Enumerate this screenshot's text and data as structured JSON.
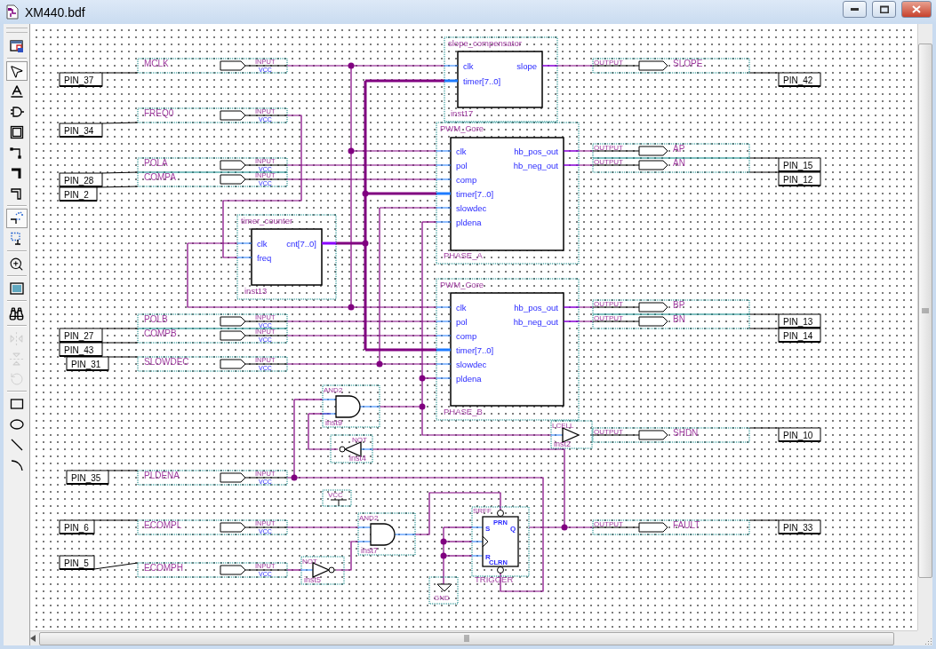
{
  "window": {
    "title": "XM440.bdf"
  },
  "toolbar": [
    {
      "kind": "window",
      "selected": false,
      "disabled": false
    },
    {
      "kind": "pointer",
      "selected": true,
      "disabled": false
    },
    {
      "kind": "text",
      "selected": false,
      "disabled": false
    },
    {
      "kind": "symbol",
      "selected": false,
      "disabled": false
    },
    {
      "kind": "block",
      "selected": false,
      "disabled": false
    },
    {
      "kind": "node",
      "selected": false,
      "disabled": false
    },
    {
      "kind": "bus",
      "selected": false,
      "disabled": false
    },
    {
      "kind": "conduit",
      "selected": false,
      "disabled": false
    },
    {
      "kind": "partial",
      "selected": true,
      "disabled": false
    },
    {
      "kind": "rubberband",
      "selected": false,
      "disabled": false
    },
    {
      "kind": "zoom",
      "selected": false,
      "disabled": false
    },
    {
      "kind": "fullscreen",
      "selected": false,
      "disabled": false
    },
    {
      "kind": "find",
      "selected": false,
      "disabled": false
    },
    {
      "kind": "fliph",
      "selected": false,
      "disabled": true
    },
    {
      "kind": "flipv",
      "selected": false,
      "disabled": true
    },
    {
      "kind": "rotate",
      "selected": false,
      "disabled": true
    },
    {
      "kind": "rectangle",
      "selected": false,
      "disabled": false
    },
    {
      "kind": "ellipse",
      "selected": false,
      "disabled": false
    },
    {
      "kind": "line",
      "selected": false,
      "disabled": false
    },
    {
      "kind": "arc",
      "selected": false,
      "disabled": false
    }
  ],
  "inputs": [
    {
      "name": "MCLK",
      "type": "INPUT",
      "default": "VCC",
      "pin": "PIN_37"
    },
    {
      "name": "FREQ0",
      "type": "INPUT",
      "default": "VCC",
      "pin": "PIN_34"
    },
    {
      "name": "POLA",
      "type": "INPUT",
      "default": "VCC",
      "pin": "PIN_28"
    },
    {
      "name": "COMPA",
      "type": "INPUT",
      "default": "VCC",
      "pin": "PIN_2"
    },
    {
      "name": "POLB",
      "type": "INPUT",
      "default": "VCC",
      "pin": "PIN_27"
    },
    {
      "name": "COMPB",
      "type": "INPUT",
      "default": "VCC",
      "pin": "PIN_43"
    },
    {
      "name": "SLOWDEC",
      "type": "INPUT",
      "default": "VCC",
      "pin": "PIN_31"
    },
    {
      "name": "PLDENA",
      "type": "INPUT",
      "default": "VCC",
      "pin": "PIN_35"
    },
    {
      "name": "ECOMPL",
      "type": "INPUT",
      "default": "VCC",
      "pin": "PIN_6"
    },
    {
      "name": "ECOMPH",
      "type": "INPUT",
      "default": "VCC",
      "pin": "PIN_5"
    }
  ],
  "outputs": [
    {
      "name": "SLOPE",
      "type": "OUTPUT",
      "pin": "PIN_42"
    },
    {
      "name": "AP",
      "type": "OUTPUT",
      "pin": "PIN_15"
    },
    {
      "name": "AN",
      "type": "OUTPUT",
      "pin": "PIN_12"
    },
    {
      "name": "BP",
      "type": "OUTPUT",
      "pin": "PIN_13"
    },
    {
      "name": "BN",
      "type": "OUTPUT",
      "pin": "PIN_14"
    },
    {
      "name": "SHDN",
      "type": "OUTPUT",
      "pin": "PIN_10"
    },
    {
      "name": "FAULT",
      "type": "OUTPUT",
      "pin": "PIN_33"
    }
  ],
  "blocks": [
    {
      "type": "slope_compensator",
      "instance": "inst17",
      "inputs": [
        "clk",
        "timer[7..0]"
      ],
      "outputs": [
        "slope"
      ]
    },
    {
      "type": "PWM_Core",
      "instance": "PHASE_A",
      "inputs": [
        "clk",
        "pol",
        "comp",
        "timer[7..0]",
        "slowdec",
        "pldena"
      ],
      "outputs": [
        "hb_pos_out",
        "hb_neg_out"
      ]
    },
    {
      "type": "PWM_Core",
      "instance": "PHASE_B",
      "inputs": [
        "clk",
        "pol",
        "comp",
        "timer[7..0]",
        "slowdec",
        "pldena"
      ],
      "outputs": [
        "hb_pos_out",
        "hb_neg_out"
      ]
    },
    {
      "type": "timer_counter",
      "instance": "inst13",
      "inputs": [
        "clk",
        "freq"
      ],
      "outputs": [
        "cnt[7..0]"
      ]
    }
  ],
  "gates": [
    {
      "kind": "and",
      "type": "AND2",
      "instance": "inst9"
    },
    {
      "kind": "not",
      "type": "NOT",
      "instance": "inst4"
    },
    {
      "kind": "lcell",
      "type": "LCELL",
      "instance": "inst2"
    },
    {
      "kind": "and",
      "type": "AND2",
      "instance": "inst7"
    },
    {
      "kind": "not",
      "type": "NOT",
      "instance": "inst5"
    }
  ],
  "flipflop": {
    "type": "SRFF",
    "instance": "TRIGGER",
    "preset": "PRN",
    "set": "S",
    "reset": "R",
    "output": "Q",
    "clear": "CLRN"
  },
  "power": [
    {
      "kind": "vcc",
      "label": "VCC"
    },
    {
      "kind": "gnd",
      "label": "GND"
    }
  ]
}
